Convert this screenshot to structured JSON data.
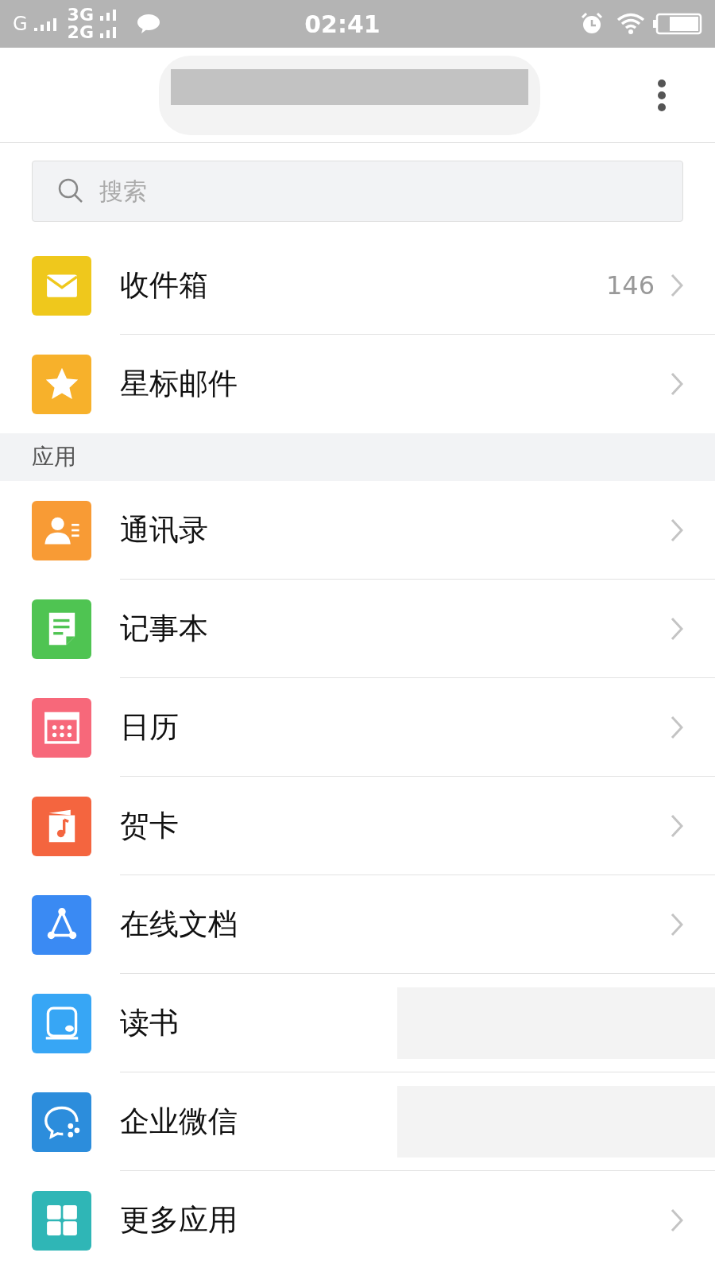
{
  "status_bar": {
    "network_1": "G",
    "network_2": "3G",
    "network_3": "2G",
    "time": "02:41"
  },
  "search": {
    "placeholder": "搜索"
  },
  "mail_items": [
    {
      "label": "收件箱",
      "count": "146",
      "color": "#efc81c",
      "chevron": true
    },
    {
      "label": "星标邮件",
      "color": "#f7b12b",
      "chevron": true
    }
  ],
  "section_title": "应用",
  "app_items": [
    {
      "label": "通讯录",
      "color": "#f89b35",
      "chevron": true,
      "redacted": false
    },
    {
      "label": "记事本",
      "color": "#4fc452",
      "chevron": true,
      "redacted": false
    },
    {
      "label": "日历",
      "color": "#f7687a",
      "chevron": true,
      "redacted": false
    },
    {
      "label": "贺卡",
      "color": "#f4653f",
      "chevron": true,
      "redacted": false
    },
    {
      "label": "在线文档",
      "color": "#3a8af3",
      "chevron": true,
      "redacted": false
    },
    {
      "label": "读书",
      "color": "#37a6f5",
      "chevron": false,
      "redacted": true
    },
    {
      "label": "企业微信",
      "color": "#2c8ddc",
      "chevron": false,
      "redacted": true
    },
    {
      "label": "更多应用",
      "color": "#2fb6b6",
      "chevron": true,
      "redacted": false
    }
  ]
}
